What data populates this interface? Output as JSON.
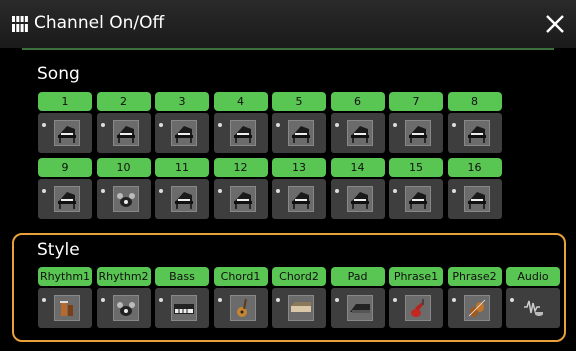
{
  "header": {
    "title": "Channel On/Off",
    "title_icon": "channel-grid-icon",
    "close_icon": "close-icon"
  },
  "song": {
    "label": "Song",
    "channels": [
      {
        "label": "1",
        "icon": "piano-icon"
      },
      {
        "label": "2",
        "icon": "piano-icon"
      },
      {
        "label": "3",
        "icon": "piano-icon"
      },
      {
        "label": "4",
        "icon": "piano-icon"
      },
      {
        "label": "5",
        "icon": "piano-icon"
      },
      {
        "label": "6",
        "icon": "piano-icon"
      },
      {
        "label": "7",
        "icon": "piano-icon"
      },
      {
        "label": "8",
        "icon": "piano-icon"
      },
      {
        "label": "9",
        "icon": "piano-icon"
      },
      {
        "label": "10",
        "icon": "drum-kit-icon"
      },
      {
        "label": "11",
        "icon": "piano-icon"
      },
      {
        "label": "12",
        "icon": "piano-icon"
      },
      {
        "label": "13",
        "icon": "piano-icon"
      },
      {
        "label": "14",
        "icon": "piano-icon"
      },
      {
        "label": "15",
        "icon": "piano-icon"
      },
      {
        "label": "16",
        "icon": "piano-icon"
      }
    ]
  },
  "style": {
    "label": "Style",
    "channels": [
      {
        "label": "Rhythm1",
        "icon": "percussion-icon"
      },
      {
        "label": "Rhythm2",
        "icon": "drum-kit-icon"
      },
      {
        "label": "Bass",
        "icon": "synth-keyboard-icon"
      },
      {
        "label": "Chord1",
        "icon": "acoustic-guitar-icon"
      },
      {
        "label": "Chord2",
        "icon": "organ-icon"
      },
      {
        "label": "Pad",
        "icon": "keyboard-icon"
      },
      {
        "label": "Phrase1",
        "icon": "electric-guitar-icon"
      },
      {
        "label": "Phrase2",
        "icon": "strings-icon"
      },
      {
        "label": "Audio",
        "icon": "audio-waveform-icon"
      }
    ]
  },
  "colors": {
    "channel_on": "#59c552",
    "accent_frame": "#e9a13a",
    "title_line": "#3b6f3c"
  }
}
